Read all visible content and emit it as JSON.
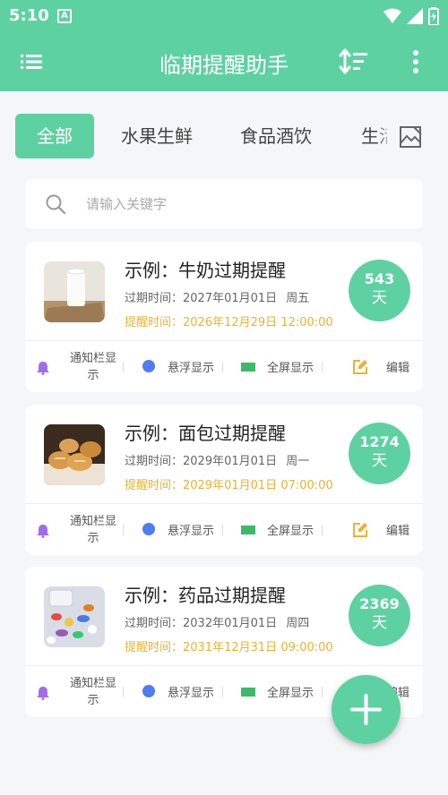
{
  "status_bar": {
    "time": "5:10",
    "notification_badge": "A"
  },
  "app_bar": {
    "title": "临期提醒助手"
  },
  "tabs": [
    {
      "label": "全部",
      "active": true
    },
    {
      "label": "水果生鲜",
      "active": false
    },
    {
      "label": "食品酒饮",
      "active": false
    },
    {
      "label": "生活",
      "active": false
    }
  ],
  "search": {
    "placeholder": "请输入关键字"
  },
  "actions": {
    "notify": "通知栏显示",
    "float": "悬浮显示",
    "fullscreen": "全屏显示",
    "edit": "编辑"
  },
  "items": [
    {
      "name": "示例：牛奶过期提醒",
      "expire_label": "过期时间：",
      "expire_date": "2027年01月01日",
      "expire_weekday": "周五",
      "remind_label": "提醒时间：",
      "remind_datetime": "2026年12月29日 12:00:00",
      "days": "543",
      "days_unit": "天",
      "image": "milk"
    },
    {
      "name": "示例：面包过期提醒",
      "expire_label": "过期时间：",
      "expire_date": "2029年01月01日",
      "expire_weekday": "周一",
      "remind_label": "提醒时间：",
      "remind_datetime": "2029年01月01日 07:00:00",
      "days": "1274",
      "days_unit": "天",
      "image": "bread"
    },
    {
      "name": "示例：药品过期提醒",
      "expire_label": "过期时间：",
      "expire_date": "2032年01月01日",
      "expire_weekday": "周四",
      "remind_label": "提醒时间：",
      "remind_datetime": "2031年12月31日 09:00:00",
      "days": "2369",
      "days_unit": "天",
      "image": "pills"
    }
  ],
  "colors": {
    "accent": "#5ed1a3",
    "remind": "#eab22e",
    "bell": "#a06ee8",
    "float_dot": "#4e7df0",
    "fullscreen": "#3db96a",
    "edit": "#f0b030"
  },
  "icons": [
    "menu-icon",
    "sort-icon",
    "more-vert-icon",
    "image-icon",
    "search-icon",
    "bell-icon",
    "float-dot-icon",
    "fullscreen-icon",
    "edit-icon",
    "add-icon"
  ]
}
